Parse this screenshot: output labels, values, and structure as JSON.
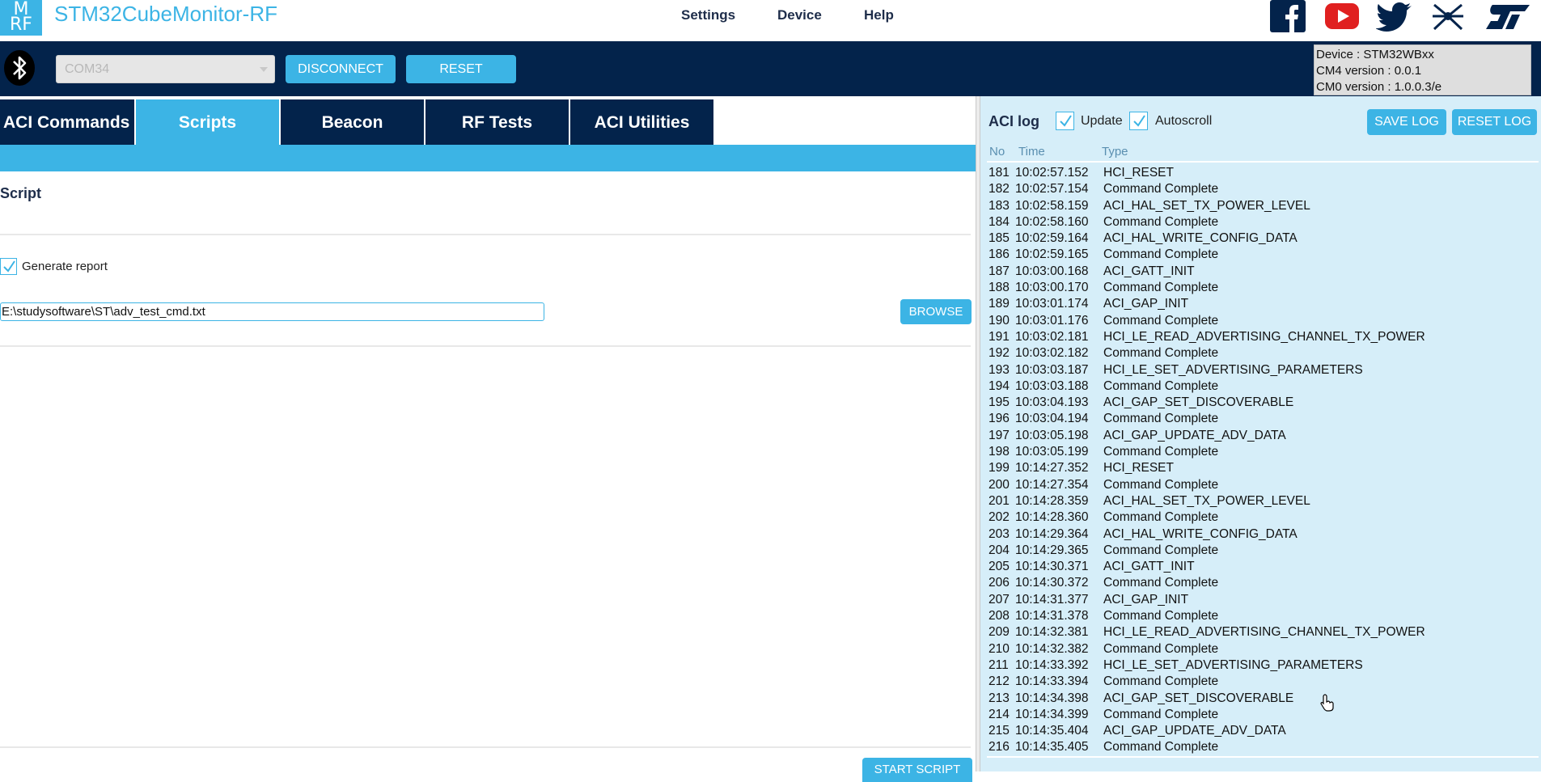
{
  "app": {
    "title": "STM32CubeMonitor-RF",
    "logo_text": "M\nRF"
  },
  "menu": {
    "settings": "Settings",
    "device": "Device",
    "help": "Help"
  },
  "social_icons": [
    "facebook-icon",
    "youtube-icon",
    "twitter-icon",
    "st-community-icon",
    "st-logo-icon"
  ],
  "connection": {
    "port": "COM34",
    "disconnect_label": "DISCONNECT",
    "reset_label": "RESET",
    "device_info": [
      "Device : STM32WBxx",
      "CM4 version : 0.0.1",
      "CM0 version : 1.0.0.3/e"
    ]
  },
  "tabs": [
    {
      "label": "ACI Commands",
      "active": false
    },
    {
      "label": "Scripts",
      "active": true
    },
    {
      "label": "Beacon",
      "active": false
    },
    {
      "label": "RF Tests",
      "active": false
    },
    {
      "label": "ACI Utilities",
      "active": false
    }
  ],
  "script_panel": {
    "heading": "Script",
    "generate_report_label": "Generate report",
    "generate_report_checked": true,
    "script_path": "E:\\studysoftware\\ST\\adv_test_cmd.txt",
    "browse_label": "BROWSE",
    "start_label": "START SCRIPT"
  },
  "log": {
    "title": "ACI log",
    "update_label": "Update",
    "update_checked": true,
    "autoscroll_label": "Autoscroll",
    "autoscroll_checked": true,
    "save_label": "SAVE LOG",
    "reset_label": "RESET LOG",
    "columns": [
      "No",
      "Time",
      "Type"
    ],
    "rows": [
      [
        "181",
        "10:02:57.152",
        "HCI_RESET"
      ],
      [
        "182",
        "10:02:57.154",
        "Command Complete"
      ],
      [
        "183",
        "10:02:58.159",
        "ACI_HAL_SET_TX_POWER_LEVEL"
      ],
      [
        "184",
        "10:02:58.160",
        "Command Complete"
      ],
      [
        "185",
        "10:02:59.164",
        "ACI_HAL_WRITE_CONFIG_DATA"
      ],
      [
        "186",
        "10:02:59.165",
        "Command Complete"
      ],
      [
        "187",
        "10:03:00.168",
        "ACI_GATT_INIT"
      ],
      [
        "188",
        "10:03:00.170",
        "Command Complete"
      ],
      [
        "189",
        "10:03:01.174",
        "ACI_GAP_INIT"
      ],
      [
        "190",
        "10:03:01.176",
        "Command Complete"
      ],
      [
        "191",
        "10:03:02.181",
        "HCI_LE_READ_ADVERTISING_CHANNEL_TX_POWER"
      ],
      [
        "192",
        "10:03:02.182",
        "Command Complete"
      ],
      [
        "193",
        "10:03:03.187",
        "HCI_LE_SET_ADVERTISING_PARAMETERS"
      ],
      [
        "194",
        "10:03:03.188",
        "Command Complete"
      ],
      [
        "195",
        "10:03:04.193",
        "ACI_GAP_SET_DISCOVERABLE"
      ],
      [
        "196",
        "10:03:04.194",
        "Command Complete"
      ],
      [
        "197",
        "10:03:05.198",
        "ACI_GAP_UPDATE_ADV_DATA"
      ],
      [
        "198",
        "10:03:05.199",
        "Command Complete"
      ],
      [
        "199",
        "10:14:27.352",
        "HCI_RESET"
      ],
      [
        "200",
        "10:14:27.354",
        "Command Complete"
      ],
      [
        "201",
        "10:14:28.359",
        "ACI_HAL_SET_TX_POWER_LEVEL"
      ],
      [
        "202",
        "10:14:28.360",
        "Command Complete"
      ],
      [
        "203",
        "10:14:29.364",
        "ACI_HAL_WRITE_CONFIG_DATA"
      ],
      [
        "204",
        "10:14:29.365",
        "Command Complete"
      ],
      [
        "205",
        "10:14:30.371",
        "ACI_GATT_INIT"
      ],
      [
        "206",
        "10:14:30.372",
        "Command Complete"
      ],
      [
        "207",
        "10:14:31.377",
        "ACI_GAP_INIT"
      ],
      [
        "208",
        "10:14:31.378",
        "Command Complete"
      ],
      [
        "209",
        "10:14:32.381",
        "HCI_LE_READ_ADVERTISING_CHANNEL_TX_POWER"
      ],
      [
        "210",
        "10:14:32.382",
        "Command Complete"
      ],
      [
        "211",
        "10:14:33.392",
        "HCI_LE_SET_ADVERTISING_PARAMETERS"
      ],
      [
        "212",
        "10:14:33.394",
        "Command Complete"
      ],
      [
        "213",
        "10:14:34.398",
        "ACI_GAP_SET_DISCOVERABLE"
      ],
      [
        "214",
        "10:14:34.399",
        "Command Complete"
      ],
      [
        "215",
        "10:14:35.404",
        "ACI_GAP_UPDATE_ADV_DATA"
      ],
      [
        "216",
        "10:14:35.405",
        "Command Complete"
      ]
    ]
  },
  "colors": {
    "brand_blue": "#3cb4e5",
    "navy": "#03234b",
    "log_bg": "#d6eef9"
  }
}
